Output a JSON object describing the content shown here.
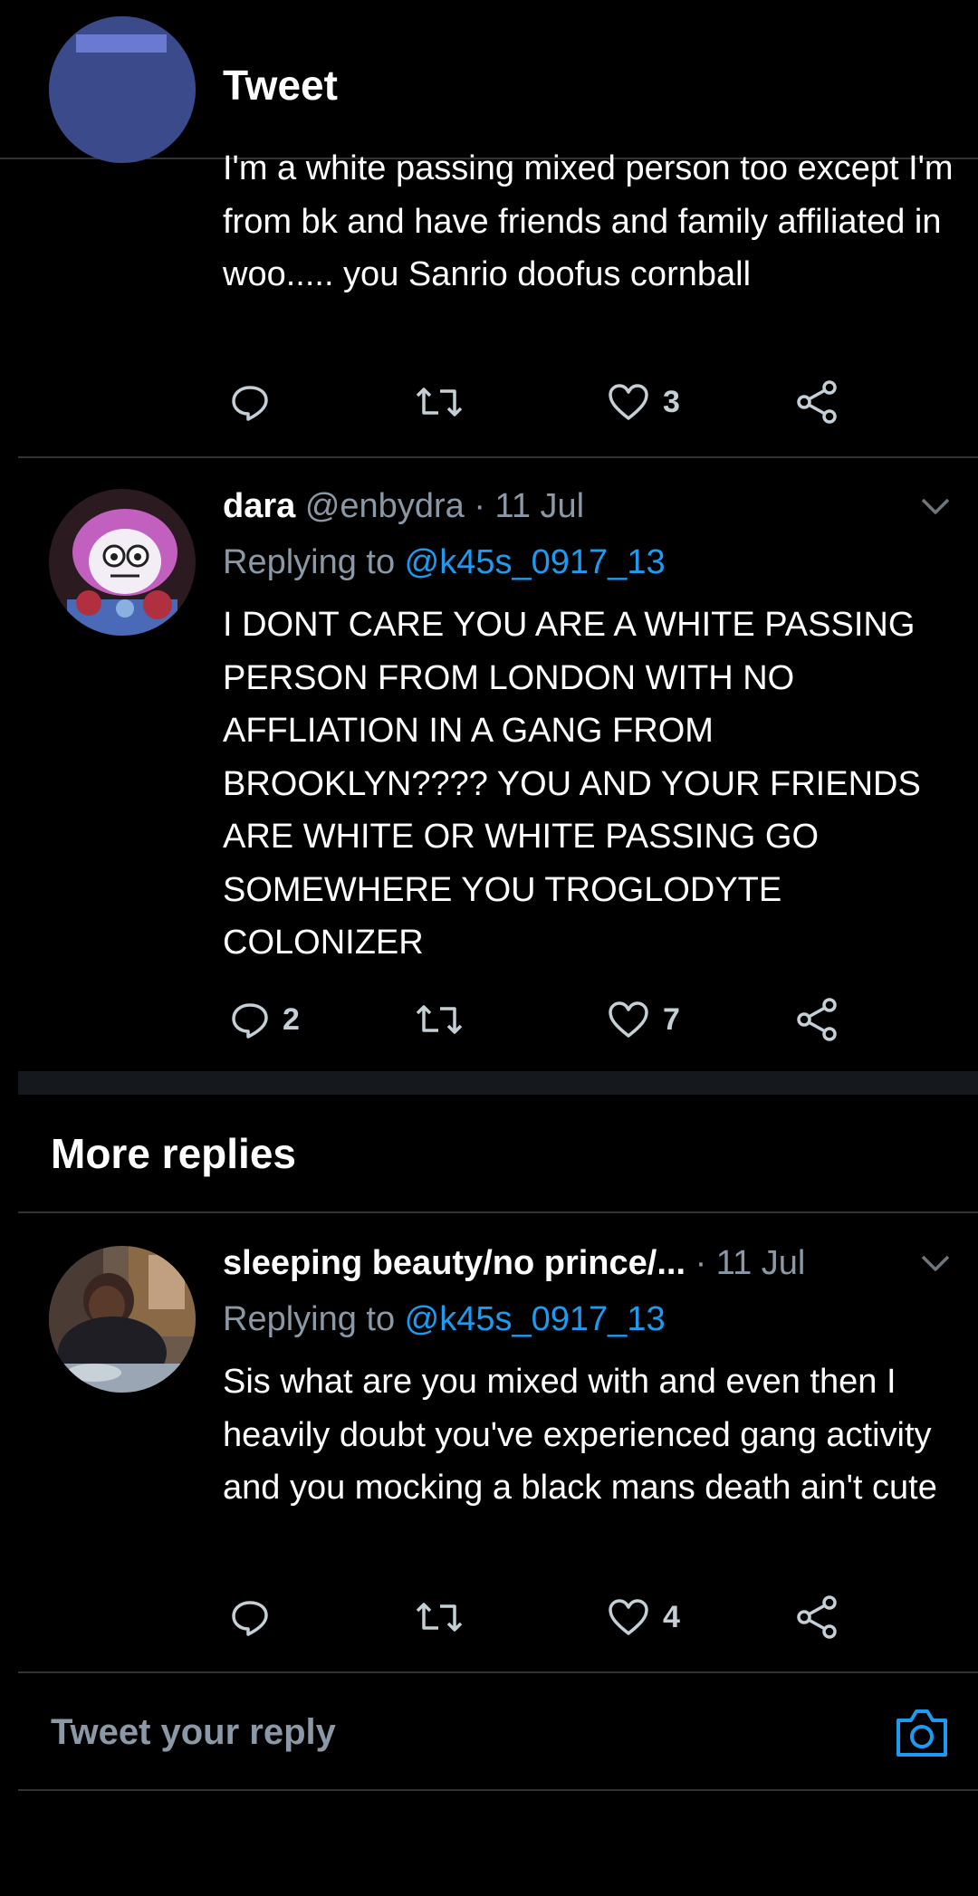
{
  "header": {
    "title": "Tweet",
    "back_icon": "back-arrow-icon",
    "accent": "#1d9bf0"
  },
  "tweets": [
    {
      "body": "I'm a white passing mixed person too except I'm from bk and have friends and family affiliated in woo..... you Sanrio doofus cornball",
      "reply_count": "",
      "retweet_count": "",
      "like_count": "3"
    },
    {
      "name": "dara",
      "handle": "@enbydra",
      "time": "· 11 Jul",
      "replying_prefix": "Replying to ",
      "replying_to": "@k45s_0917_13",
      "body": "I DONT CARE YOU ARE A WHITE PASSING PERSON FROM LONDON WITH NO AFFLIATION IN A GANG FROM BROOKLYN???? YOU AND YOUR FRIENDS ARE WHITE OR WHITE PASSING GO SOMEWHERE YOU TROGLODYTE COLONIZER",
      "reply_count": "2",
      "retweet_count": "",
      "like_count": "7"
    },
    {
      "name": "sleeping beauty/no prince/...",
      "handle": "",
      "time": "· 11 Jul",
      "replying_prefix": "Replying to ",
      "replying_to": "@k45s_0917_13",
      "body": "Sis what are you mixed with and even then I heavily doubt you've experienced gang activity and you mocking a black mans death ain't cute",
      "reply_count": "",
      "retweet_count": "",
      "like_count": "4"
    }
  ],
  "section": {
    "title": "More replies"
  },
  "composer": {
    "placeholder": "Tweet your reply",
    "camera_icon": "camera-icon"
  }
}
